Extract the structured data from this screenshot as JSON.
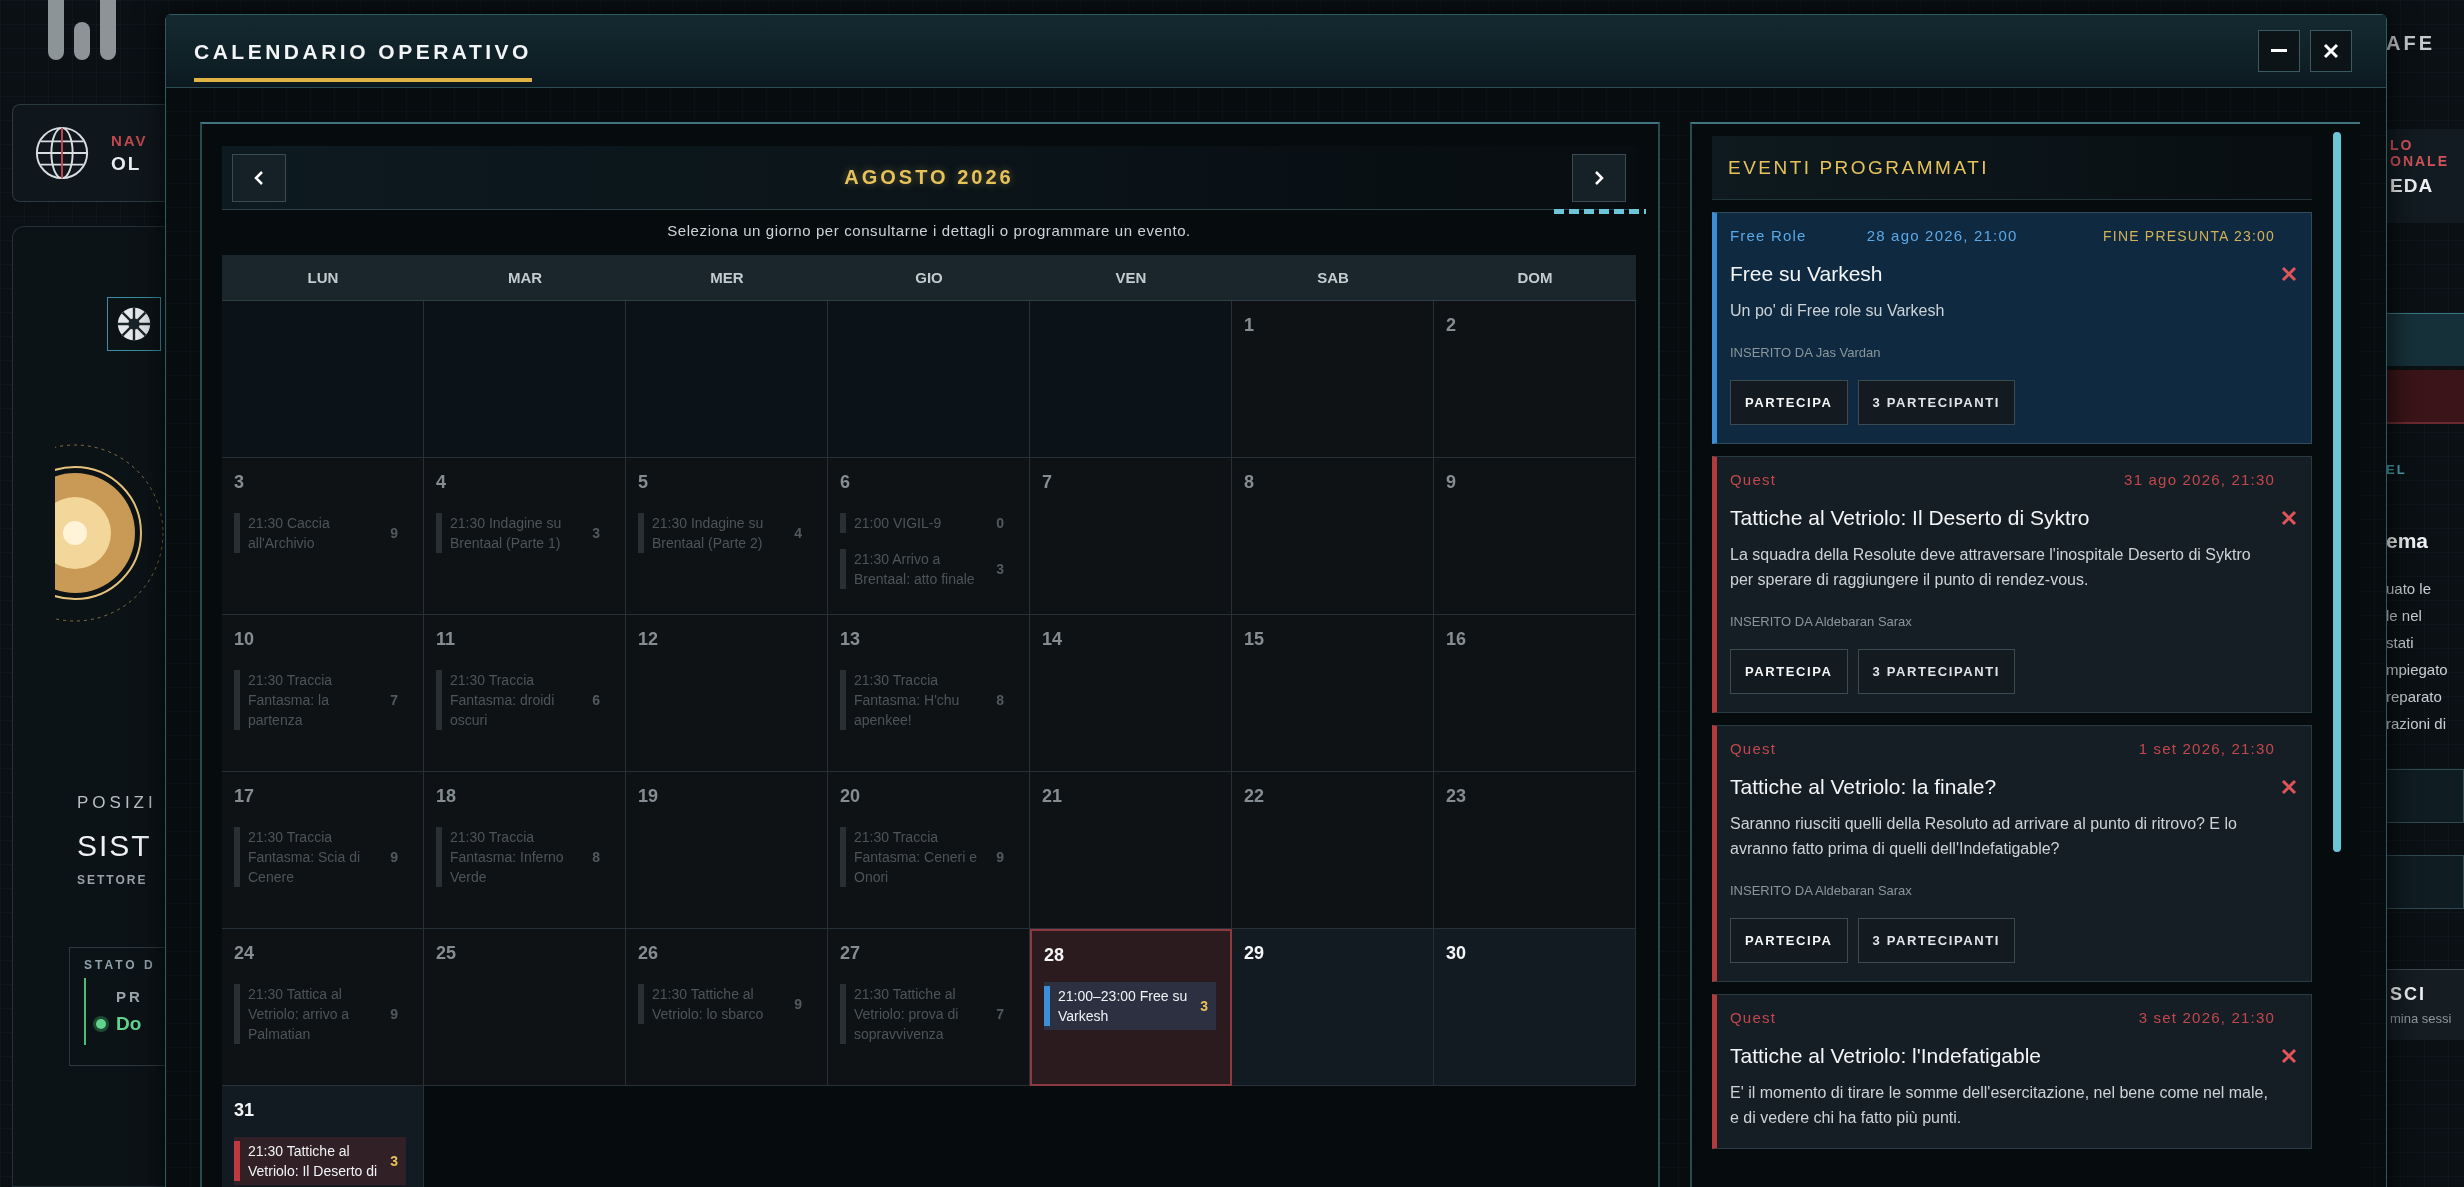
{
  "background": {
    "left": {
      "nav_label": "NAV",
      "nav_value": "OL",
      "position_label": "POSIZI",
      "system": "SIST",
      "sector": "SETTORE",
      "status_label": "STATO D",
      "status_title": "PR",
      "status_value": "Do"
    },
    "right": {
      "top": "AFE",
      "label_lines": [
        "LO",
        "ONALE"
      ],
      "value": "EDA",
      "section": "EL",
      "heading": "ema",
      "lines": [
        "uato le",
        "le nel",
        "stati",
        "mpiegato",
        "reparato",
        "razioni di"
      ],
      "exit_title": "SCI",
      "exit_sub": "mina sessi"
    }
  },
  "modal": {
    "title": "CALENDARIO OPERATIVO"
  },
  "calendar": {
    "month": "AGOSTO 2026",
    "hint": "Seleziona un giorno per consultarne i dettagli o programmare un evento.",
    "weekdays": [
      "LUN",
      "MAR",
      "MER",
      "GIO",
      "VEN",
      "SAB",
      "DOM"
    ],
    "weeks": [
      [
        {
          "kind": "blank"
        },
        {
          "kind": "blank"
        },
        {
          "kind": "blank"
        },
        {
          "kind": "blank"
        },
        {
          "kind": "blank"
        },
        {
          "kind": "day",
          "day": "1",
          "past": true,
          "selected": false
        },
        {
          "kind": "day",
          "day": "2",
          "past": true,
          "selected": false
        }
      ],
      [
        {
          "kind": "day",
          "day": "3",
          "past": true,
          "selected": false,
          "events": [
            {
              "text": "21:30 Caccia all'Archivio",
              "count": "9"
            }
          ]
        },
        {
          "kind": "day",
          "day": "4",
          "past": true,
          "selected": false,
          "events": [
            {
              "text": "21:30 Indagine su Brentaal (Parte 1)",
              "count": "3"
            }
          ]
        },
        {
          "kind": "day",
          "day": "5",
          "past": true,
          "selected": false,
          "events": [
            {
              "text": "21:30 Indagine su Brentaal (Parte 2)",
              "count": "4"
            }
          ]
        },
        {
          "kind": "day",
          "day": "6",
          "past": true,
          "selected": false,
          "events": [
            {
              "text": "21:00 VIGIL-9",
              "count": "0"
            },
            {
              "text": "21:30 Arrivo a Brentaal: atto finale",
              "count": "3"
            }
          ]
        },
        {
          "kind": "day",
          "day": "7",
          "past": true,
          "selected": false
        },
        {
          "kind": "day",
          "day": "8",
          "past": true,
          "selected": false
        },
        {
          "kind": "day",
          "day": "9",
          "past": true,
          "selected": false
        }
      ],
      [
        {
          "kind": "day",
          "day": "10",
          "past": true,
          "selected": false,
          "events": [
            {
              "text": "21:30 Traccia Fantasma: la partenza",
              "count": "7"
            }
          ]
        },
        {
          "kind": "day",
          "day": "11",
          "past": true,
          "selected": false,
          "events": [
            {
              "text": "21:30 Traccia Fantasma: droidi oscuri",
              "count": "6"
            }
          ]
        },
        {
          "kind": "day",
          "day": "12",
          "past": true,
          "selected": false
        },
        {
          "kind": "day",
          "day": "13",
          "past": true,
          "selected": false,
          "events": [
            {
              "text": "21:30 Traccia Fantasma: H'chu apenkee!",
              "count": "8"
            }
          ]
        },
        {
          "kind": "day",
          "day": "14",
          "past": true,
          "selected": false
        },
        {
          "kind": "day",
          "day": "15",
          "past": true,
          "selected": false
        },
        {
          "kind": "day",
          "day": "16",
          "past": true,
          "selected": false
        }
      ],
      [
        {
          "kind": "day",
          "day": "17",
          "past": true,
          "selected": false,
          "events": [
            {
              "text": "21:30 Traccia Fantasma: Scia di Cenere",
              "count": "9"
            }
          ]
        },
        {
          "kind": "day",
          "day": "18",
          "past": true,
          "selected": false,
          "events": [
            {
              "text": "21:30 Traccia Fantasma: Inferno Verde",
              "count": "8"
            }
          ]
        },
        {
          "kind": "day",
          "day": "19",
          "past": true,
          "selected": false
        },
        {
          "kind": "day",
          "day": "20",
          "past": true,
          "selected": false,
          "events": [
            {
              "text": "21:30 Traccia Fantasma: Ceneri e Onori",
              "count": "9"
            }
          ]
        },
        {
          "kind": "day",
          "day": "21",
          "past": true,
          "selected": false
        },
        {
          "kind": "day",
          "day": "22",
          "past": true,
          "selected": false
        },
        {
          "kind": "day",
          "day": "23",
          "past": true,
          "selected": false
        }
      ],
      [
        {
          "kind": "day",
          "day": "24",
          "past": true,
          "selected": false,
          "events": [
            {
              "text": "21:30 Tattica al Vetriolo: arrivo a Palmatian",
              "count": "9"
            }
          ]
        },
        {
          "kind": "day",
          "day": "25",
          "past": true,
          "selected": false
        },
        {
          "kind": "day",
          "day": "26",
          "past": true,
          "selected": false,
          "events": [
            {
              "text": "21:30 Tattiche al Vetriolo: lo sbarco",
              "count": "9"
            }
          ]
        },
        {
          "kind": "day",
          "day": "27",
          "past": true,
          "selected": false,
          "events": [
            {
              "text": "21:30 Tattiche al Vetriolo: prova di sopravvivenza",
              "count": "7"
            }
          ]
        },
        {
          "kind": "day",
          "day": "28",
          "past": false,
          "selected": true,
          "events": [
            {
              "text": "21:00–23:00 Free su Varkesh",
              "count": "3",
              "color": "#3a8fd6"
            }
          ]
        },
        {
          "kind": "day",
          "day": "29",
          "past": false,
          "selected": false
        },
        {
          "kind": "day",
          "day": "30",
          "past": false,
          "selected": false
        }
      ],
      [
        {
          "kind": "day",
          "day": "31",
          "past": false,
          "selected": false,
          "events": [
            {
              "text": "21:30 Tattiche al Vetriolo: Il Deserto di",
              "count": "3",
              "color": "#c0393f"
            }
          ]
        }
      ]
    ]
  },
  "events_panel": {
    "title": "EVENTI PROGRAMMATI",
    "events": [
      {
        "selected": true,
        "kind": "freerole",
        "category": "Free Role",
        "date": "28 ago 2026, 21:00",
        "end": "FINE PRESUNTA 23:00",
        "title": "Free su Varkesh",
        "description": "Un po' di Free role su Varkesh",
        "author": "INSERITO DA Jas Vardan",
        "buttons": [
          "PARTECIPA",
          "3 PARTECIPANTI"
        ]
      },
      {
        "selected": false,
        "kind": "quest",
        "category": "Quest",
        "date": "31 ago 2026, 21:30",
        "title": "Tattiche al Vetriolo: Il Deserto di Syktro",
        "description": "La squadra della Resolute deve attraversare l'inospitale Deserto di Syktro per sperare di raggiungere il punto di rendez-vous.",
        "author": "INSERITO DA Aldebaran Sarax",
        "buttons": [
          "PARTECIPA",
          "3 PARTECIPANTI"
        ]
      },
      {
        "selected": false,
        "kind": "quest",
        "category": "Quest",
        "date": "1 set 2026, 21:30",
        "title": "Tattiche al Vetriolo: la finale?",
        "description": "Saranno riusciti quelli della Resoluto ad arrivare al punto di ritrovo? E lo avranno fatto prima di quelli dell'Indefatigable?",
        "author": "INSERITO DA Aldebaran Sarax",
        "buttons": [
          "PARTECIPA",
          "3 PARTECIPANTI"
        ]
      },
      {
        "selected": false,
        "kind": "quest",
        "category": "Quest",
        "date": "3 set 2026, 21:30",
        "title": "Tattiche al Vetriolo: l'Indefatigable",
        "description": "E' il momento di tirare le somme dell'esercitazione, nel bene come nel male, e di vedere chi ha fatto più punti."
      }
    ]
  }
}
